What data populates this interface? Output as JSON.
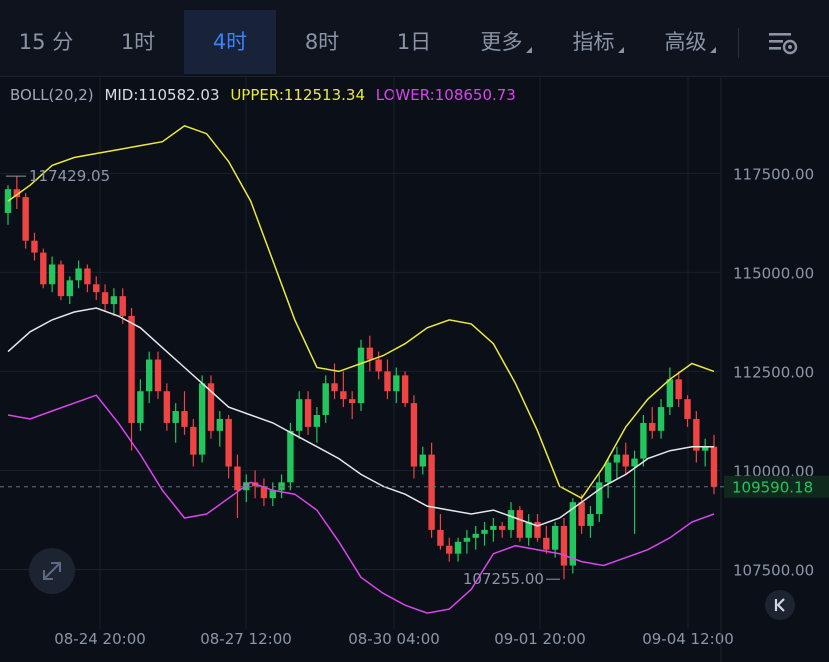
{
  "tabs": [
    {
      "label": "15 分",
      "active": false
    },
    {
      "label": "1时",
      "active": false
    },
    {
      "label": "4时",
      "active": true
    },
    {
      "label": "8时",
      "active": false
    },
    {
      "label": "1日",
      "active": false
    },
    {
      "label": "更多",
      "active": false,
      "dropdown": true
    },
    {
      "label": "指标",
      "active": false,
      "dropdown": true
    },
    {
      "label": "高级",
      "active": false,
      "dropdown": true
    }
  ],
  "indicator": {
    "name": "BOLL(20,2)",
    "mid_label": "MID:110582.03",
    "upper_label": "UPPER:112513.34",
    "lower_label": "LOWER:108650.73"
  },
  "colors": {
    "up": "#22c55e",
    "down": "#ef4444",
    "mid": "#e5e7eb",
    "upper": "#eaea3c",
    "lower": "#d946ef",
    "grid": "#1a202c",
    "axis_text": "#8d96a8",
    "active_tab": "#3b82f6"
  },
  "chart_data": {
    "type": "candlestick",
    "y_ticks": [
      "117500.00",
      "115000.00",
      "112500.00",
      "110000.00",
      "107500.00"
    ],
    "x_ticks": [
      "08-24 20:00",
      "08-27 12:00",
      "08-30 04:00",
      "09-01 20:00",
      "09-04 12:00"
    ],
    "ylim": [
      106200,
      119200
    ],
    "last_price": "109590.18",
    "high_marker": "117429.05",
    "low_marker": "107255.00",
    "candles": [
      [
        116500,
        117200,
        116200,
        117100
      ],
      [
        117100,
        117429,
        116600,
        116900
      ],
      [
        116900,
        117000,
        115600,
        115800
      ],
      [
        115800,
        116000,
        115300,
        115500
      ],
      [
        115500,
        115600,
        114600,
        114700
      ],
      [
        114700,
        115400,
        114500,
        115200
      ],
      [
        115200,
        115300,
        114300,
        114400
      ],
      [
        114400,
        114900,
        114200,
        114800
      ],
      [
        114800,
        115300,
        114600,
        115100
      ],
      [
        115100,
        115200,
        114500,
        114700
      ],
      [
        114700,
        114900,
        114300,
        114500
      ],
      [
        114500,
        114700,
        114000,
        114200
      ],
      [
        114200,
        114600,
        113900,
        114400
      ],
      [
        114400,
        114600,
        113700,
        113900
      ],
      [
        113900,
        114100,
        110500,
        111200
      ],
      [
        111200,
        112300,
        111000,
        112000
      ],
      [
        112000,
        113000,
        111700,
        112800
      ],
      [
        112800,
        113000,
        111800,
        112000
      ],
      [
        112000,
        112200,
        111000,
        111200
      ],
      [
        111200,
        111700,
        110700,
        111500
      ],
      [
        111500,
        112000,
        110900,
        111100
      ],
      [
        111100,
        111300,
        110100,
        110400
      ],
      [
        110400,
        112400,
        110200,
        112200
      ],
      [
        112200,
        112400,
        110800,
        111000
      ],
      [
        111000,
        111500,
        110600,
        111300
      ],
      [
        111300,
        111400,
        109800,
        110100
      ],
      [
        110100,
        110400,
        108800,
        109500
      ],
      [
        109500,
        109900,
        109200,
        109700
      ],
      [
        109700,
        110000,
        109300,
        109600
      ],
      [
        109600,
        109800,
        109100,
        109300
      ],
      [
        109300,
        109700,
        109100,
        109500
      ],
      [
        109500,
        109900,
        109300,
        109700
      ],
      [
        109700,
        111200,
        109500,
        111000
      ],
      [
        111000,
        112000,
        110800,
        111800
      ],
      [
        111800,
        112000,
        110900,
        111100
      ],
      [
        111100,
        111600,
        110700,
        111400
      ],
      [
        111400,
        112400,
        111200,
        112200
      ],
      [
        112200,
        112700,
        111800,
        112000
      ],
      [
        112000,
        112500,
        111600,
        111800
      ],
      [
        111800,
        112000,
        111300,
        111700
      ],
      [
        111700,
        113300,
        111500,
        113100
      ],
      [
        113100,
        113400,
        112500,
        112800
      ],
      [
        112800,
        113000,
        112300,
        112500
      ],
      [
        112500,
        112800,
        111800,
        112000
      ],
      [
        112000,
        112600,
        111700,
        112400
      ],
      [
        112400,
        112500,
        111600,
        111700
      ],
      [
        111700,
        111900,
        109800,
        110100
      ],
      [
        110100,
        110600,
        109900,
        110400
      ],
      [
        110400,
        110700,
        108300,
        108500
      ],
      [
        108500,
        108900,
        108000,
        108100
      ],
      [
        108100,
        108300,
        107700,
        107900
      ],
      [
        107900,
        108300,
        107700,
        108200
      ],
      [
        108200,
        108500,
        107900,
        108300
      ],
      [
        108300,
        108600,
        108000,
        108400
      ],
      [
        108400,
        108700,
        108100,
        108500
      ],
      [
        108500,
        108800,
        108200,
        108600
      ],
      [
        108600,
        108700,
        108300,
        108500
      ],
      [
        108500,
        109200,
        108300,
        109000
      ],
      [
        109000,
        109100,
        108200,
        108300
      ],
      [
        108300,
        108900,
        108100,
        108700
      ],
      [
        108700,
        108900,
        108200,
        108300
      ],
      [
        108300,
        108600,
        107900,
        108000
      ],
      [
        108000,
        108700,
        107800,
        108600
      ],
      [
        108600,
        108800,
        107255,
        107600
      ],
      [
        107600,
        109300,
        107400,
        109200
      ],
      [
        109200,
        109400,
        108400,
        108600
      ],
      [
        108600,
        109100,
        108300,
        108900
      ],
      [
        108900,
        109900,
        108700,
        109700
      ],
      [
        109700,
        110300,
        109300,
        110200
      ],
      [
        110200,
        110600,
        109800,
        110400
      ],
      [
        110400,
        110700,
        109900,
        110100
      ],
      [
        110100,
        110500,
        108400,
        110300
      ],
      [
        110300,
        111400,
        110100,
        111200
      ],
      [
        111200,
        111600,
        110800,
        111000
      ],
      [
        111000,
        111800,
        110800,
        111600
      ],
      [
        111600,
        112600,
        111400,
        112300
      ],
      [
        112300,
        112500,
        111600,
        111800
      ],
      [
        111800,
        111900,
        111100,
        111300
      ],
      [
        111300,
        111500,
        110200,
        110500
      ],
      [
        110500,
        110800,
        110100,
        110600
      ],
      [
        110600,
        110900,
        109400,
        109590
      ]
    ],
    "bands": {
      "upper": [
        116800,
        117200,
        117700,
        117900,
        118000,
        118100,
        118200,
        118300,
        118700,
        118500,
        117800,
        116800,
        115300,
        113800,
        112600,
        112500,
        112700,
        112900,
        113200,
        113600,
        113800,
        113700,
        113200,
        112200,
        111000,
        109600,
        109300,
        110100,
        111100,
        111800,
        112300,
        112700,
        112500
      ],
      "mid": [
        113000,
        113500,
        113800,
        114000,
        114100,
        113900,
        113600,
        113100,
        112600,
        112100,
        111600,
        111400,
        111200,
        110900,
        110600,
        110300,
        109900,
        109600,
        109400,
        109100,
        109000,
        108900,
        109000,
        108800,
        108600,
        108800,
        109200,
        109600,
        109900,
        110300,
        110500,
        110600,
        110600
      ],
      "lower": [
        111400,
        111300,
        111500,
        111700,
        111900,
        111200,
        110400,
        109500,
        108800,
        108900,
        109300,
        109700,
        109500,
        109400,
        109000,
        108200,
        107300,
        106900,
        106600,
        106400,
        106500,
        107000,
        107900,
        108100,
        108000,
        107900,
        107700,
        107600,
        107800,
        108000,
        108300,
        108700,
        108900
      ]
    }
  }
}
